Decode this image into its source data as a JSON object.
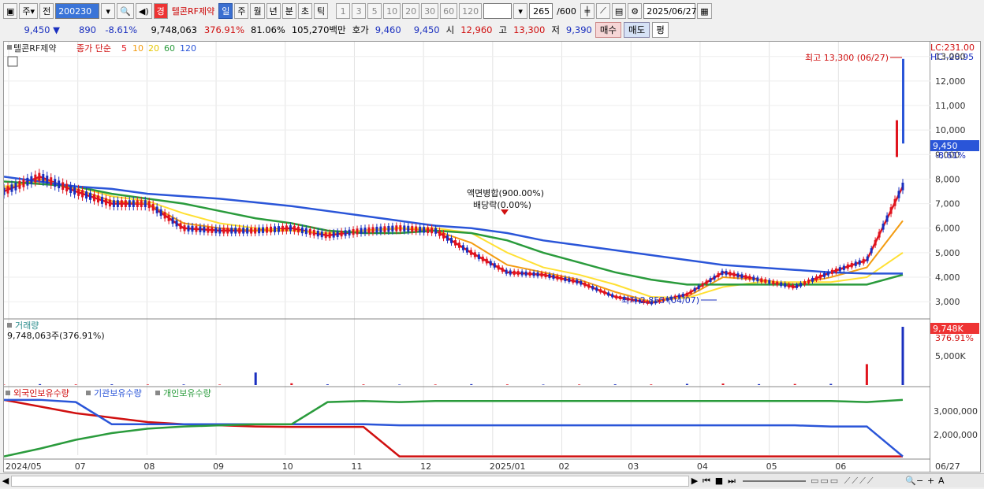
{
  "toolbar": {
    "period": "주",
    "prev_label": "전",
    "code": "200230",
    "stock_badge": "경",
    "stock_name": "텔콘RF제약",
    "timeframes": [
      "일",
      "주",
      "월",
      "년",
      "분",
      "초",
      "틱"
    ],
    "active_timeframe": "일",
    "intervals": [
      "1",
      "3",
      "5",
      "10",
      "20",
      "30",
      "60",
      "120"
    ],
    "count": "265",
    "count_max": "/600",
    "date": "2025/06/27"
  },
  "quote": {
    "price": "9,450",
    "change": "890",
    "change_pct": "-8.61%",
    "volume": "9,748,063",
    "vol_ratio": "376.91%",
    "turnover_pct": "81.06%",
    "amount": "105,270백만",
    "ask_label": "호가",
    "ask1": "9,460",
    "ask2": "9,450",
    "open_label": "시",
    "open": "12,960",
    "high_label": "고",
    "high": "13,300",
    "low_label": "저",
    "low": "9,390",
    "buy_label": "매수",
    "sell_label": "매도",
    "eval_label": "평"
  },
  "legend": {
    "name": "텔콘RF제약",
    "ma_label": "종가 단순",
    "ma_periods": [
      "5",
      "10",
      "20",
      "60",
      "120"
    ],
    "ma_colors": [
      "#e0141e",
      "#f39c12",
      "#ffe033",
      "#2a9b3c",
      "#2a55d8"
    ]
  },
  "annotations": {
    "high": "최고 13,300 (06/27)",
    "low": "최저 2,855 (04/07)",
    "split": "액면병합(900.00%)",
    "dividend": "배당락(0.00%)"
  },
  "right_labels": {
    "lc": "LC:231.00",
    "hc": "HC:-28.95",
    "last_price": "9,450",
    "last_pct": "-8.61%",
    "vol_last": "9,748K",
    "vol_pct": "376.91%"
  },
  "volume_panel": {
    "title": "거래량",
    "value": "9,748,063주(376.91%)"
  },
  "holdings_panel": {
    "series": [
      "외국인보유수량",
      "기관보유수량",
      "개인보유수량"
    ],
    "colors": [
      "#d01010",
      "#2a55d8",
      "#2a9b3c"
    ]
  },
  "chart_data": [
    {
      "type": "line",
      "title": "텔콘RF제약",
      "x": [
        "2024/05",
        "07",
        "08",
        "09",
        "10",
        "11",
        "12",
        "2025/01",
        "02",
        "03",
        "04",
        "05",
        "06",
        "06/27"
      ],
      "ylim": [
        2300,
        13600
      ],
      "yticks": [
        "3,000",
        "4,000",
        "5,000",
        "6,000",
        "7,000",
        "8,000",
        "9,000",
        "10,000",
        "11,000",
        "12,000",
        "13,000"
      ],
      "series": [
        {
          "name": "5",
          "values": [
            7500,
            8100,
            7500,
            7000,
            7000,
            6000,
            5900,
            5900,
            6000,
            5700,
            5900,
            6000,
            5900,
            5000,
            4200,
            4100,
            3800,
            3200,
            2950,
            3300,
            4200,
            3900,
            3600,
            4200,
            4700,
            7700
          ]
        },
        {
          "name": "10",
          "values": [
            7600,
            8000,
            7600,
            7100,
            7000,
            6200,
            6000,
            5900,
            5900,
            5800,
            5900,
            6000,
            5900,
            5400,
            4500,
            4200,
            3900,
            3400,
            3000,
            3200,
            4000,
            3900,
            3700,
            4000,
            4400,
            6300
          ]
        },
        {
          "name": "20",
          "values": [
            7700,
            7900,
            7700,
            7300,
            7100,
            6600,
            6200,
            6000,
            5900,
            5800,
            5900,
            6000,
            6000,
            5800,
            5000,
            4400,
            4100,
            3700,
            3200,
            3150,
            3600,
            3800,
            3800,
            3800,
            4000,
            5000
          ]
        },
        {
          "name": "60",
          "values": [
            7900,
            7800,
            7700,
            7400,
            7200,
            7000,
            6700,
            6400,
            6200,
            5900,
            5800,
            5800,
            5900,
            5800,
            5500,
            5000,
            4600,
            4200,
            3900,
            3700,
            3700,
            3700,
            3700,
            3700,
            3700,
            4100
          ]
        },
        {
          "name": "120",
          "values": [
            8100,
            7900,
            7700,
            7600,
            7400,
            7300,
            7200,
            7050,
            6900,
            6700,
            6500,
            6300,
            6100,
            6000,
            5800,
            5500,
            5300,
            5100,
            4900,
            4700,
            4500,
            4400,
            4300,
            4200,
            4150,
            4150
          ]
        }
      ]
    },
    {
      "type": "bar",
      "title": "거래량",
      "x": [
        "2024/05",
        "2025/06/27"
      ],
      "yticks": [
        "5,000K"
      ],
      "series": [
        {
          "name": "거래량",
          "values": [
            80000,
            150000,
            100000,
            120000,
            90000,
            100000,
            80000,
            2100000,
            300000,
            120000,
            100000,
            80000,
            90000,
            150000,
            100000,
            80000,
            90000,
            120000,
            100000,
            200000,
            250000,
            150000,
            180000,
            200000,
            3500000,
            9748063
          ]
        }
      ]
    },
    {
      "type": "line",
      "title": "보유수량",
      "yticks": [
        "2,000,000",
        "3,000,000"
      ],
      "series": [
        {
          "name": "외국인보유수량",
          "values": [
            3600000,
            3300000,
            3000000,
            2800000,
            2600000,
            2500000,
            2450000,
            2400000,
            2380000,
            2380000,
            2380000,
            1050000,
            1050000,
            1050000,
            1050000,
            1050000,
            1050000,
            1050000,
            1050000,
            1050000,
            1050000,
            1050000,
            1050000,
            1050000,
            1050000,
            1050000
          ]
        },
        {
          "name": "기관보유수량",
          "values": [
            3600000,
            3600000,
            3500000,
            2500000,
            2500000,
            2500000,
            2500000,
            2500000,
            2500000,
            2500000,
            2500000,
            2450000,
            2450000,
            2450000,
            2450000,
            2450000,
            2450000,
            2450000,
            2450000,
            2450000,
            2450000,
            2450000,
            2450000,
            2400000,
            2400000,
            1050000
          ]
        },
        {
          "name": "개인보유수량",
          "values": [
            1050000,
            1400000,
            1800000,
            2100000,
            2300000,
            2400000,
            2450000,
            2500000,
            2500000,
            3500000,
            3550000,
            3500000,
            3550000,
            3550000,
            3550000,
            3550000,
            3550000,
            3550000,
            3550000,
            3550000,
            3550000,
            3550000,
            3550000,
            3550000,
            3500000,
            3600000
          ]
        }
      ]
    }
  ],
  "x_axis_labels": [
    "2024/05",
    "07",
    "08",
    "09",
    "10",
    "11",
    "12",
    "2025/01",
    "02",
    "03",
    "04",
    "05",
    "06"
  ],
  "x_last_label": "06/27",
  "vol_tick": "5,000K",
  "hold_ticks": [
    "3,000,000",
    "2,000,000"
  ]
}
